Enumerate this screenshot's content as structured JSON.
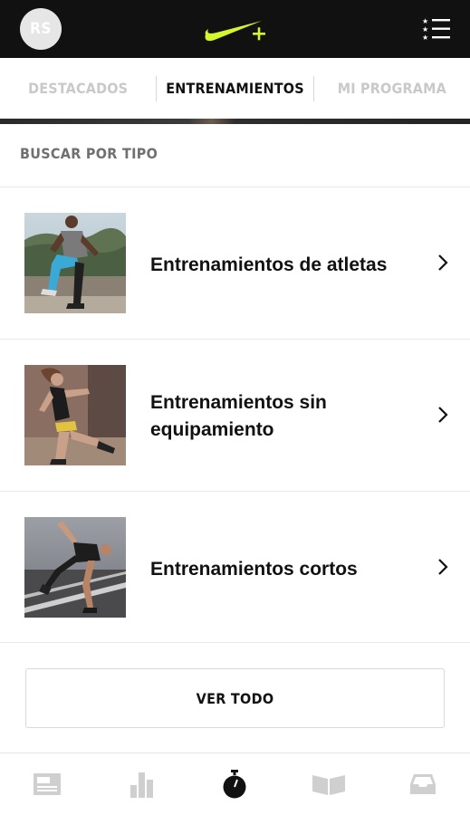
{
  "header": {
    "avatar_initials": "RS",
    "logo_icon": "nike-swoosh-plus-icon",
    "menu_icon": "star-list-menu-icon",
    "logo_color": "#d4f72c"
  },
  "tabs": [
    {
      "label": "DESTACADOS",
      "active": false
    },
    {
      "label": "ENTRENAMIENTOS",
      "active": true
    },
    {
      "label": "MI PROGRAMA",
      "active": false
    }
  ],
  "section": {
    "title": "BUSCAR POR TIPO"
  },
  "workout_types": [
    {
      "label_lines": [
        "Entrenamientos de atletas"
      ],
      "image": "athlete-workout-photo"
    },
    {
      "label_lines": [
        "Entrenamientos sin",
        "equipamiento"
      ],
      "image": "no-equipment-workout-photo"
    },
    {
      "label_lines": [
        "Entrenamientos cortos"
      ],
      "image": "short-workout-photo"
    }
  ],
  "see_all_label": "VER TODO",
  "bottom_nav": [
    {
      "icon": "feed-icon",
      "active": false
    },
    {
      "icon": "stats-bar-chart-icon",
      "active": false
    },
    {
      "icon": "stopwatch-icon",
      "active": true
    },
    {
      "icon": "open-book-icon",
      "active": false
    },
    {
      "icon": "inbox-tray-icon",
      "active": false
    }
  ]
}
